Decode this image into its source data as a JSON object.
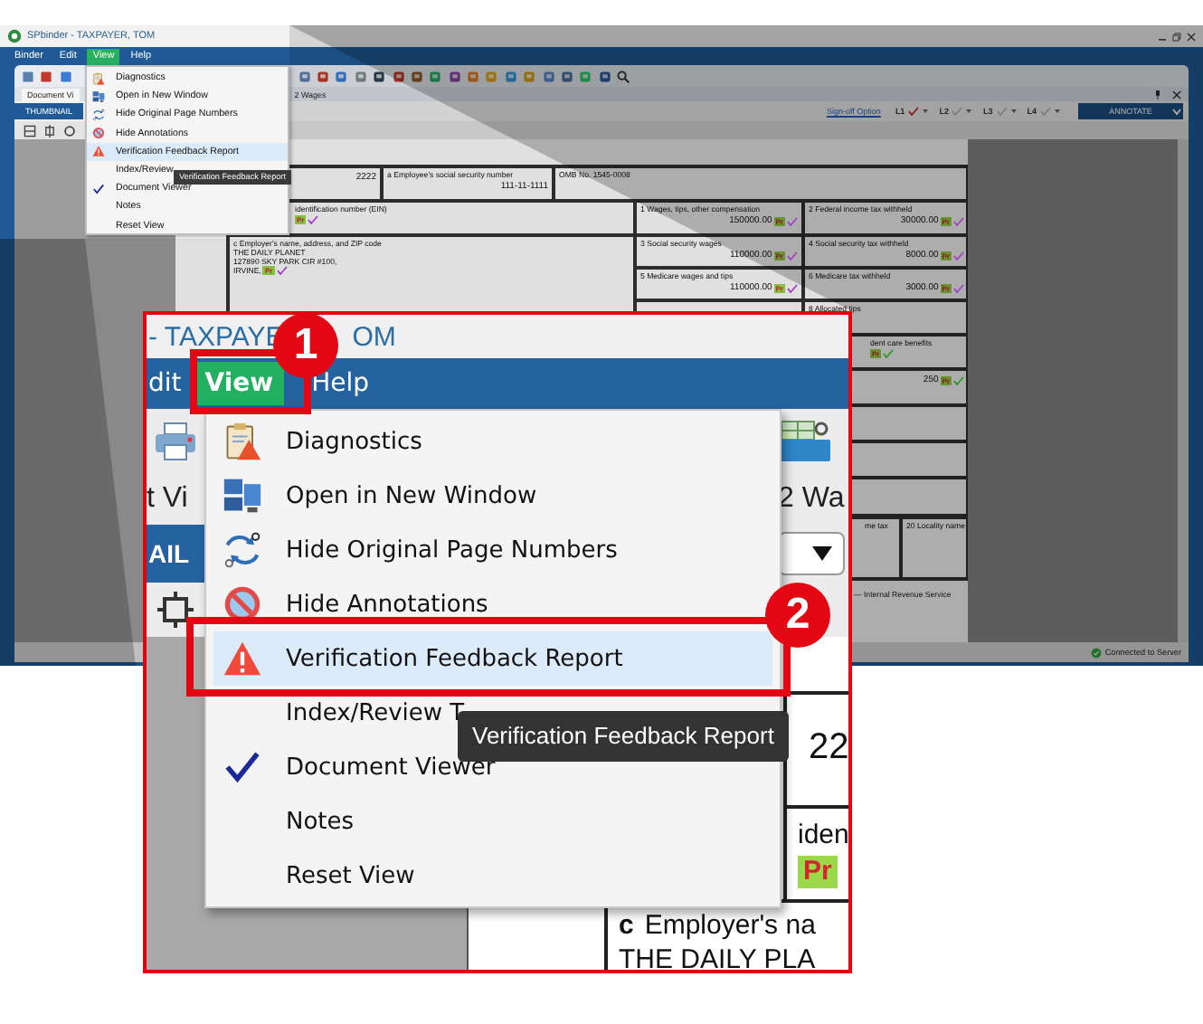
{
  "app": {
    "title": "SPbinder - TAXPAYER, TOM",
    "menu_bar": [
      {
        "label": "Binder",
        "selected": false
      },
      {
        "label": "Edit",
        "selected": false
      },
      {
        "label": "View",
        "selected": true
      },
      {
        "label": "Help",
        "selected": false
      }
    ],
    "view_menu": {
      "items": [
        {
          "label": "Diagnostics",
          "selected": false,
          "checked": false
        },
        {
          "label": "Open in New Window",
          "selected": false,
          "checked": false
        },
        {
          "label": "Hide Original Page Numbers",
          "selected": false,
          "checked": false
        },
        {
          "label": "Hide Annotations",
          "selected": false,
          "checked": false
        },
        {
          "label": "Verification Feedback Report",
          "selected": true,
          "checked": false
        },
        {
          "label": "Index/Review",
          "selected": false,
          "checked": false
        },
        {
          "label": "Document Viewer",
          "selected": false,
          "checked": true
        },
        {
          "label": "Notes",
          "selected": false,
          "checked": false
        },
        {
          "label": "Reset View",
          "selected": false,
          "checked": false
        }
      ],
      "tooltip": "Verification Feedback Report"
    },
    "panel_tab": "Document Vi",
    "panel_title": "2 Wages",
    "thumbnail_tab": "THUMBNAIL",
    "sign_off": {
      "link": "Sign-off Option",
      "levels": [
        {
          "label": "L1",
          "checked": true
        },
        {
          "label": "L2",
          "checked": false
        },
        {
          "label": "L3",
          "checked": false
        },
        {
          "label": "L4",
          "checked": false
        }
      ]
    },
    "annotate": "ANNOTATE",
    "form": {
      "cells": [
        {
          "value": "2222"
        },
        {
          "label": "a  Employee's social security number",
          "value": "111-11-1111"
        },
        {
          "label": "OMB No. 1545-0008"
        },
        {
          "label": "identification number (EIN)",
          "tag": "Pr",
          "color": "#a23fc4",
          "kind": "clipped"
        },
        {
          "label": "1  Wages, tips, other compensation",
          "value": "150000.00",
          "tag": "Pr",
          "color": "#a23fc4"
        },
        {
          "label": "2  Federal income tax withheld",
          "value": "30000.00",
          "tag": "Pr",
          "color": "#a23fc4"
        },
        {
          "label": "c  Employer's name, address, and ZIP code",
          "lines": [
            "THE DAILY PLANET",
            "127890 SKY PARK CIR #100,",
            "IRVINE,"
          ],
          "tag": "Pr",
          "color": "#a23fc4"
        },
        {
          "label": "3  Social security wages",
          "value": "110000.00",
          "tag": "Pr",
          "color": "#a23fc4"
        },
        {
          "label": "4  Social security tax withheld",
          "value": "8000.00",
          "tag": "Pr",
          "color": "#a23fc4"
        },
        {
          "label": "5  Medicare wages and tips",
          "value": "110000.00",
          "tag": "Pr",
          "color": "#a23fc4"
        },
        {
          "label": "6  Medicare tax withheld",
          "value": "3000.00",
          "tag": "Pr",
          "color": "#a23fc4"
        },
        {
          "label": "8  Allocated tips"
        },
        {
          "label": "dent care benefits",
          "tag": "Pr",
          "color": "#2b9a2b",
          "kind": "clipped"
        },
        {
          "value": "250",
          "tag": "Pr",
          "color": "#2b9a2b"
        },
        {
          "label": "me tax",
          "kind": "clipped"
        },
        {
          "label": "20  Locality name"
        }
      ],
      "footer": "— Internal Revenue Service"
    },
    "status": "Connected to Server"
  },
  "callout": {
    "title_parts": [
      "- TAXPAYE",
      "OM"
    ],
    "menu_bar": [
      {
        "label": "dit",
        "selected": false
      },
      {
        "label": "View",
        "selected": true
      },
      {
        "label": "Help",
        "selected": false
      }
    ],
    "view_label": "t Vi",
    "tab": "AIL",
    "page_title": "2 Wa",
    "menu": {
      "items": [
        {
          "label": "Diagnostics",
          "selected": false,
          "checked": false
        },
        {
          "label": "Open in New Window",
          "selected": false,
          "checked": false
        },
        {
          "label": "Hide Original Page Numbers",
          "selected": false,
          "checked": false
        },
        {
          "label": "Hide Annotations",
          "selected": false,
          "checked": false
        },
        {
          "label": "Verification Feedback Report",
          "selected": true,
          "checked": false
        },
        {
          "label": "Index/Review T",
          "selected": false,
          "checked": false
        },
        {
          "label": "Document Viewer",
          "selected": false,
          "checked": true
        },
        {
          "label": "Notes",
          "selected": false,
          "checked": false
        },
        {
          "label": "Reset View",
          "selected": false,
          "checked": false
        }
      ],
      "tooltip": "Verification Feedback Report"
    },
    "form": {
      "number": "22",
      "label": "iden",
      "tag": "Pr",
      "box_code": "c",
      "box_label": "Employer's na",
      "line": "THE DAILY PLA"
    },
    "steps": [
      "1",
      "2"
    ]
  }
}
